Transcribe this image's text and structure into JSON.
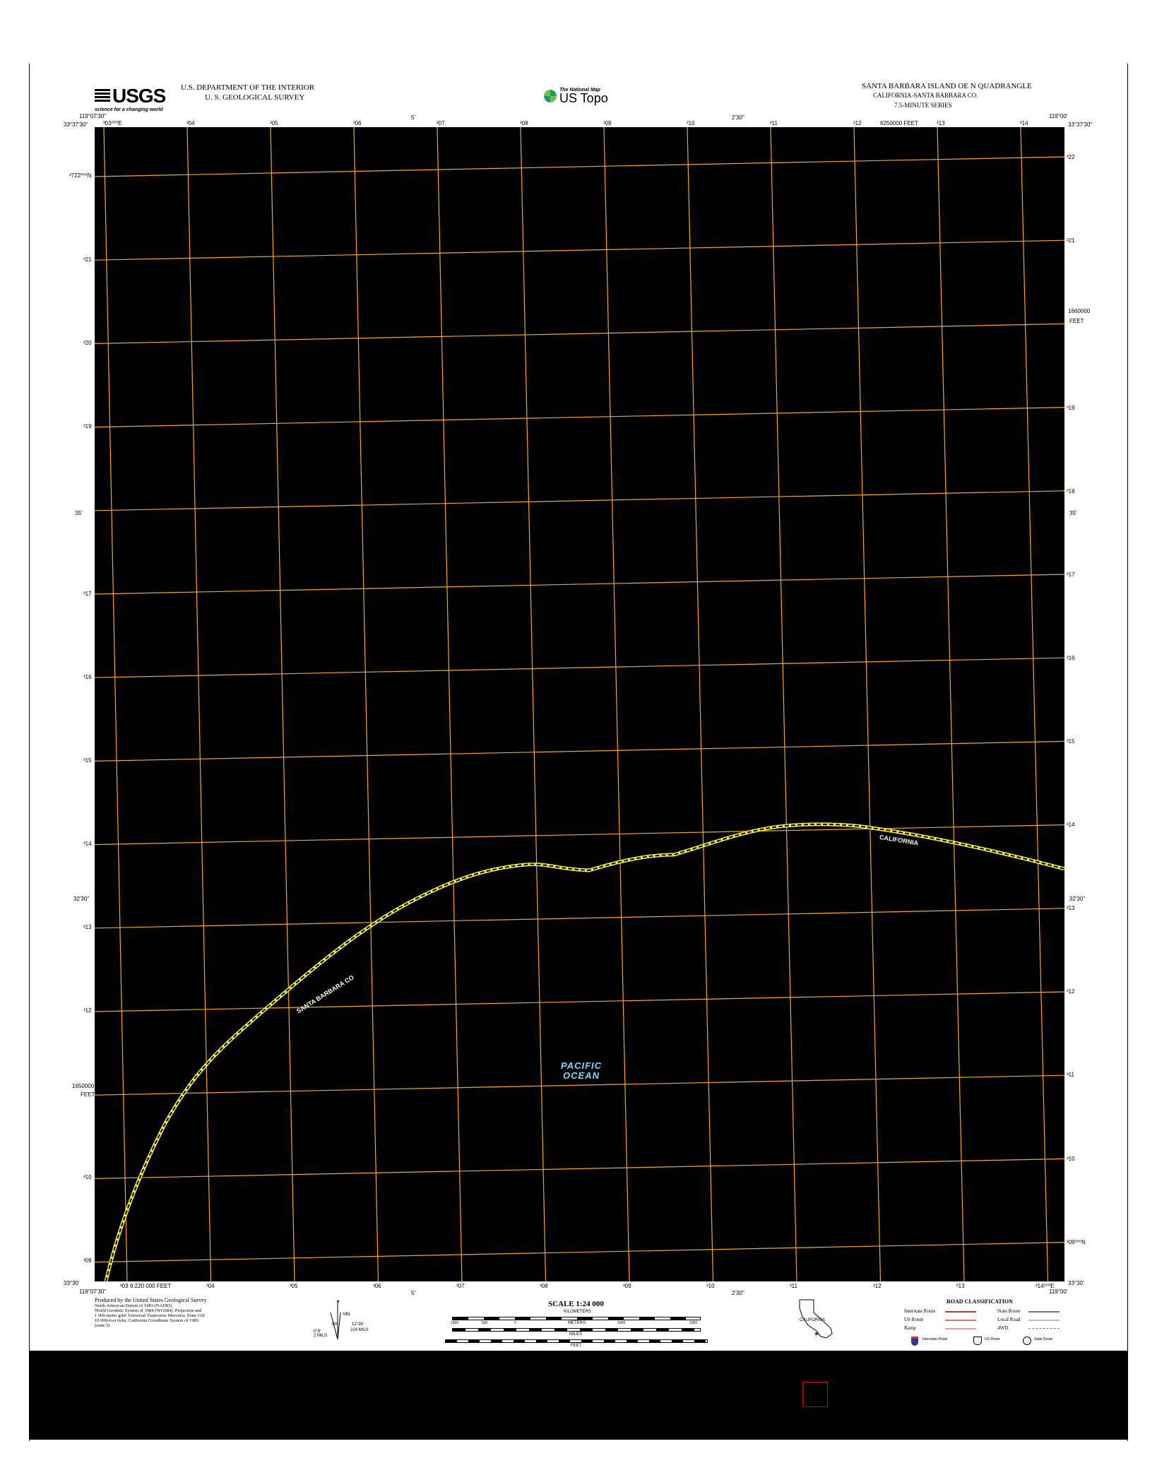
{
  "header": {
    "usgs_logo_text": "USGS",
    "usgs_tagline": "science for a changing world",
    "department": "U.S. DEPARTMENT OF THE INTERIOR",
    "survey": "U. S. GEOLOGICAL SURVEY",
    "national_map": "The National Map",
    "us_topo": "US Topo",
    "quad_title": "SANTA BARBARA ISLAND OE N QUADRANGLE",
    "state_county": "CALIFORNIA-SANTA BARBARA CO.",
    "series": "7.5-MINUTE SERIES"
  },
  "corners": {
    "top_left_lon": "119°07'30\"",
    "top_left_lat": "33°37'30\"",
    "top_right_lon": "119°00'",
    "top_right_lat": "33°37'30\"",
    "bottom_left_lat": "33°30'",
    "bottom_left_lon": "119°07'30\"",
    "bottom_right_lat": "33°30'",
    "bottom_right_lon": "119°00'"
  },
  "top_ticks": [
    "³03⁰⁰⁰E",
    "³04",
    "³05",
    "³06",
    "³07",
    "³08",
    "³09",
    "³10",
    "³11",
    "³12",
    "³13",
    "³14"
  ],
  "top_minutes": [
    "5'",
    "2'30\""
  ],
  "top_feet": "6250000 FEET",
  "bottom_ticks": [
    "³03",
    "³04",
    "³05",
    "³06",
    "³07",
    "³08",
    "³09",
    "³10",
    "³11",
    "³12",
    "³13",
    "³14⁰⁰⁰E"
  ],
  "bottom_feet": "6 220 000 FEET",
  "bottom_minutes": [
    "5'",
    "2'30\""
  ],
  "left_ticks": [
    "³722⁰⁰⁰N",
    "³21",
    "³20",
    "³19",
    "³17",
    "³16",
    "³15",
    "³14",
    "³13",
    "³12",
    "³10",
    "³09"
  ],
  "left_minutes": [
    "35'",
    "32'30\""
  ],
  "left_feet": [
    "1650000",
    "FEET"
  ],
  "right_ticks": [
    "³22",
    "³21",
    "³19",
    "³18",
    "³17",
    "³16",
    "³15",
    "³14",
    "³13",
    "³12",
    "³11",
    "³10",
    "³09⁰⁰⁰N"
  ],
  "right_minutes": [
    "35'",
    "32'30\""
  ],
  "right_feet": [
    "1660000",
    "FEET"
  ],
  "map_labels": {
    "water": [
      "PACIFIC",
      "OCEAN"
    ],
    "county_line": "SANTA BARBARA CO",
    "state_line": "CALIFORNIA"
  },
  "footer": {
    "produced_by": "Produced by the United States Geological Survey",
    "datum_lines": [
      "North American Datum of 1983 (NAD83)",
      "World Geodetic System of 1984 (WGS84). Projection and",
      "1 000-meter grid: Universal Transverse Mercator, Zone 11S",
      "10 000-foot ticks: California Coordinate System of 1983",
      "(zone 5)"
    ],
    "declination": [
      "MN",
      "GN",
      "12°26'",
      "224 MILS",
      "0°8'",
      "2 MILS"
    ],
    "scale_title": "SCALE 1:24 000",
    "scale_units": [
      "KILOMETERS",
      "METERS",
      "MILES",
      "FEET"
    ],
    "km_ticks": [
      "1",
      "0.5",
      "0",
      "1",
      "2"
    ],
    "meter_ticks": [
      "1000",
      "500",
      "0",
      "1000",
      "2000"
    ],
    "mile_ticks": [
      "1",
      "0.5",
      "0",
      "1"
    ],
    "feet_ticks": [
      "1000",
      "0",
      "1000",
      "2000",
      "3000",
      "4000",
      "5000",
      "6000",
      "7000",
      "8000",
      "9000",
      "10000"
    ],
    "state_label": "CALIFORNIA",
    "legend_title": "ROAD CLASSIFICATION",
    "legend_left": [
      "Interstate Route",
      "US Route",
      "Ramp"
    ],
    "legend_right": [
      "State Route",
      "Local Road",
      "4WD"
    ],
    "shields": [
      "Interstate Route",
      "US Route",
      "State Route"
    ]
  },
  "colors": {
    "grid": "#f5a623",
    "boundary": "#f2ee3c",
    "water_text": "#7fd9ff",
    "marker": "#cc0000"
  }
}
